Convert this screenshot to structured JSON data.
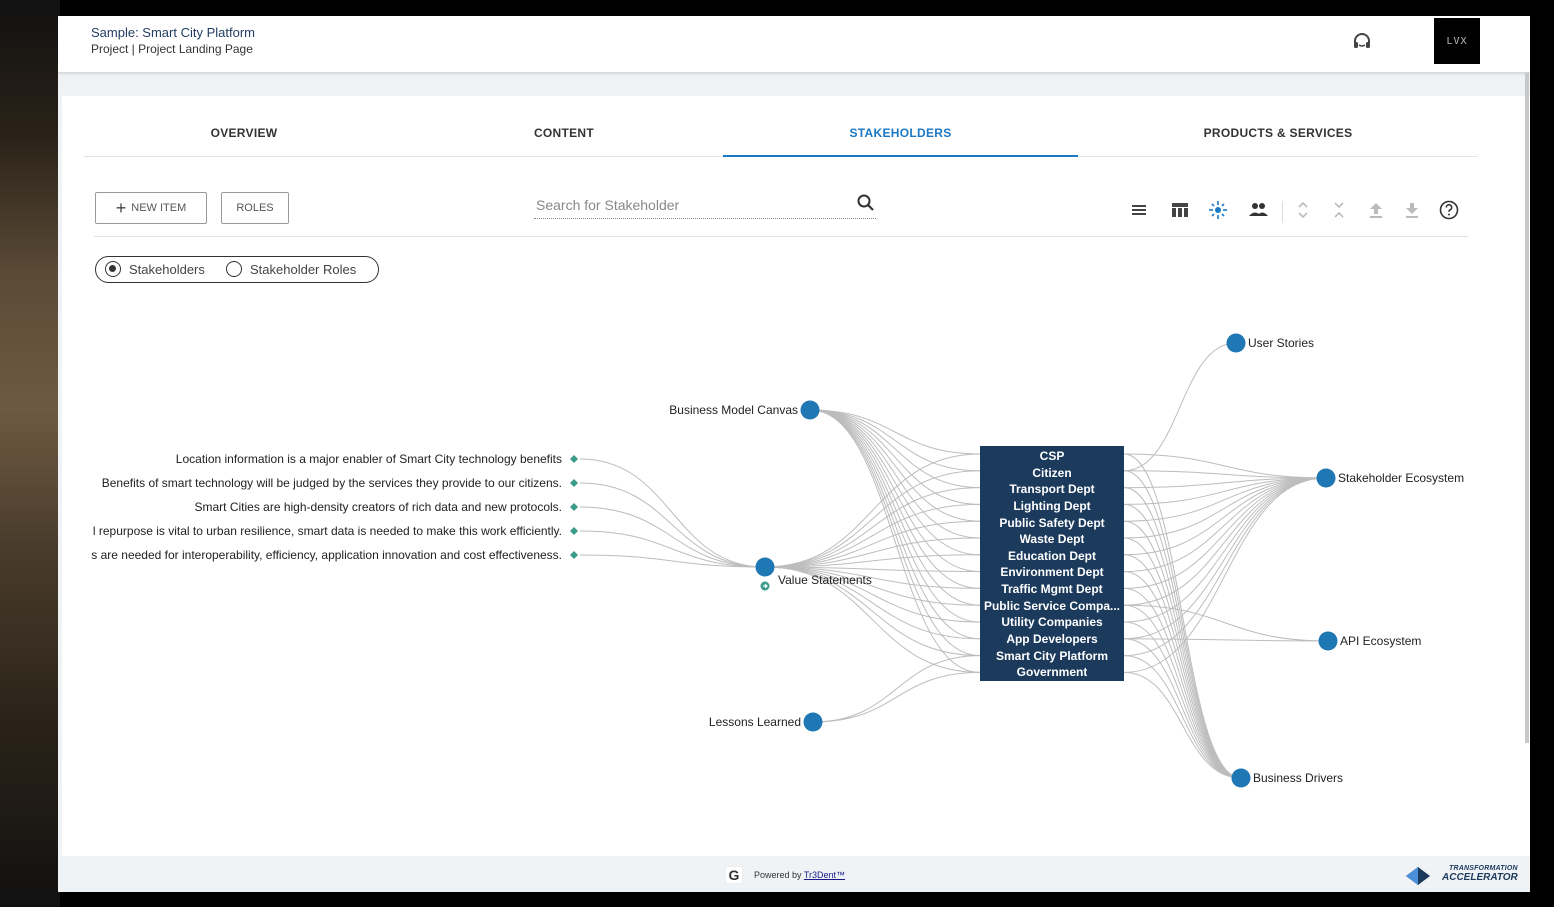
{
  "header": {
    "project_title": "Sample: Smart City Platform",
    "project_subtitle": "Project | Project Landing Page",
    "logo_text": "LVX"
  },
  "tabs": [
    {
      "label": "OVERVIEW",
      "active": false
    },
    {
      "label": "CONTENT",
      "active": false
    },
    {
      "label": "STAKEHOLDERS",
      "active": true
    },
    {
      "label": "PRODUCTS & SERVICES",
      "active": false
    }
  ],
  "actions": {
    "new_item_label": "NEW ITEM",
    "roles_label": "ROLES"
  },
  "search": {
    "placeholder": "Search for Stakeholder",
    "value": ""
  },
  "toolbar": {
    "icons": [
      "list-view-icon",
      "table-view-icon",
      "network-view-icon",
      "people-view-icon",
      "expand-icon",
      "collapse-icon",
      "upload-icon",
      "download-icon",
      "help-icon"
    ]
  },
  "view_toggle": {
    "options": [
      "Stakeholders",
      "Stakeholder Roles"
    ],
    "selected": "Stakeholders"
  },
  "graph": {
    "statements": [
      "Location information is a major enabler of Smart City technology benefits",
      "Benefits of smart technology will be judged by the services they provide to our citizens.",
      "Smart Cities are high-density creators of rich data and new protocols.",
      "l repurpose is vital to urban resilience, smart data is needed to make this work efficiently.",
      "s are needed for interoperability, efficiency, application innovation and cost effectiveness."
    ],
    "left_nodes": [
      "Business Model Canvas",
      "Value Statements",
      "Lessons Learned"
    ],
    "stakeholders": [
      "CSP",
      "Citizen",
      "Transport Dept",
      "Lighting Dept",
      "Public Safety Dept",
      "Waste Dept",
      "Education Dept",
      "Environment Dept",
      "Traffic Mgmt Dept",
      "Public Service Compa...",
      "Utility Companies",
      "App Developers",
      "Smart City Platform",
      "Government"
    ],
    "right_nodes": [
      "User Stories",
      "Stakeholder Ecosystem",
      "API Ecosystem",
      "Business Drivers"
    ],
    "colors": {
      "node": "#1f77b4",
      "diamond": "#3a9a8a",
      "link": "#bdbdbd",
      "box": "#1b3a5c"
    }
  },
  "footer": {
    "powered_by": "Powered by",
    "brand": "Tr3Dent™",
    "ta_line1": "TRANSFORMATION",
    "ta_line2": "ACCELERATOR"
  },
  "colors": {
    "accent": "#1b78c4",
    "title": "#1f3b5f"
  }
}
